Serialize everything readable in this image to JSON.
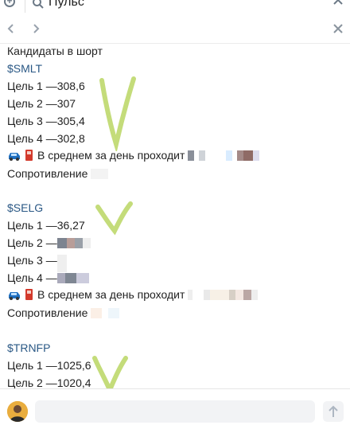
{
  "search": {
    "query": "Пульс"
  },
  "post": {
    "header": "Кандидаты в шорт",
    "blocks": [
      {
        "ticker": "$SMLT",
        "targets": [
          "Цель 1 —308,6",
          "Цель 2 —307",
          "Цель 3 —305,4",
          "Цель 4 —302,8"
        ],
        "average": "В среднем за день проходит",
        "resistance": "Сопротивление"
      },
      {
        "ticker": "$SELG",
        "targets": [
          "Цель 1 —36,27",
          "Цель 2 —",
          "Цель 3 —",
          "Цель 4 —"
        ],
        "average": "В среднем за день проходит",
        "resistance": "Сопротивление"
      },
      {
        "ticker": "$TRNFP",
        "targets": [
          "Цель 1 —1025,6",
          "Цель 2 —1020,4"
        ]
      }
    ]
  },
  "icons": {
    "add": "plus-circle-icon",
    "search": "search-icon",
    "close": "close-icon",
    "back": "chevron-left-icon",
    "forward": "chevron-right-icon",
    "emoji_car": "car-emoji-icon",
    "emoji_fuel": "fuel-pump-emoji-icon",
    "send": "send-arrow-icon"
  },
  "colors": {
    "ticker": "#2a5885",
    "checkmark": "#c4dc7a"
  }
}
